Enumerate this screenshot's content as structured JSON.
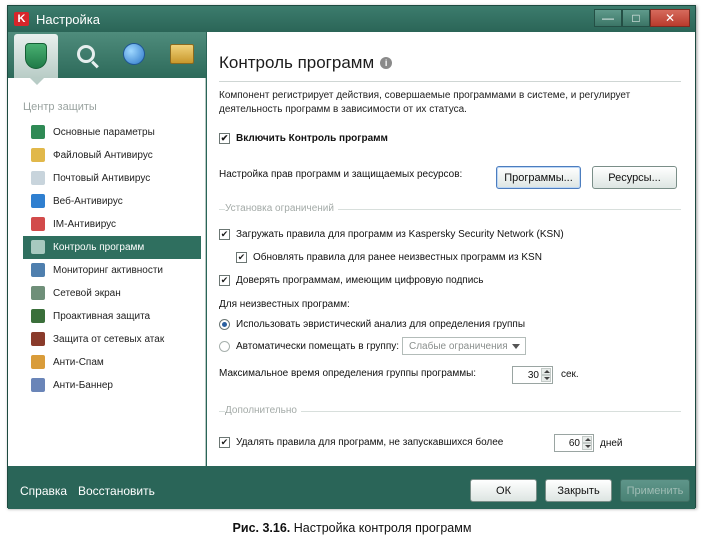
{
  "window": {
    "title": "Настройка",
    "app_icon_letter": "K",
    "controls": [
      "—",
      "□",
      "✕"
    ]
  },
  "sidebar": {
    "tabs": [
      "shield-icon",
      "search-icon",
      "globe-icon",
      "briefcase-icon"
    ],
    "section_title": "Центр защиты",
    "items": [
      {
        "label": "Основные параметры",
        "icon": "shield-icon",
        "color": "#2f8a55"
      },
      {
        "label": "Файловый Антивирус",
        "icon": "folder-icon",
        "color": "#e1b84a"
      },
      {
        "label": "Почтовый Антивирус",
        "icon": "envelope-icon",
        "color": "#c8d4dc"
      },
      {
        "label": "Веб-Антивирус",
        "icon": "globe-icon",
        "color": "#2f7fd0"
      },
      {
        "label": "IM-Антивирус",
        "icon": "chat-icon",
        "color": "#d24b4b"
      },
      {
        "label": "Контроль программ",
        "icon": "filter-icon",
        "color": "#a7c9bf",
        "active": true
      },
      {
        "label": "Мониторинг активности",
        "icon": "monitor-icon",
        "color": "#4f7fae"
      },
      {
        "label": "Сетевой экран",
        "icon": "hourglass-icon",
        "color": "#6f8f79"
      },
      {
        "label": "Проактивная защита",
        "icon": "shield-check-icon",
        "color": "#3a6f3a"
      },
      {
        "label": "Защита от сетевых атак",
        "icon": "computer-icon",
        "color": "#8a3b2b"
      },
      {
        "label": "Анти-Спам",
        "icon": "envelope-warning-icon",
        "color": "#d99c3a"
      },
      {
        "label": "Анти-Баннер",
        "icon": "banner-icon",
        "color": "#6a85b8"
      }
    ]
  },
  "main": {
    "heading": "Контроль программ",
    "help_glyph": "i",
    "description": "Компонент регистрирует действия, совершаемые программами в системе, и регулирует деятельность программ в зависимости от их статуса.",
    "enable_label": "Включить Контроль программ",
    "rights_label": "Настройка прав программ и защищаемых ресурсов:",
    "programs_button": "Программы...",
    "resources_button": "Ресурсы...",
    "group_restrictions": "Установка ограничений",
    "load_ksn": "Загружать правила для программ из Kaspersky Security Network (KSN)",
    "update_rules": "Обновлять правила для ранее неизвестных программ из KSN",
    "trust_signed": "Доверять программам, имеющим цифровую подпись",
    "unknown_label": "Для неизвестных программ:",
    "radio_heuristic": "Использовать эвристический анализ для определения группы",
    "radio_auto": "Автоматически помещать в группу:",
    "group_select": "Слабые ограничения",
    "max_time_label": "Максимальное время определения группы программы:",
    "max_time_value": "30",
    "max_time_unit": "сек.",
    "group_additional": "Дополнительно",
    "delete_rules": "Удалять правила для программ, не запускавшихся более",
    "days_value": "60",
    "days_unit": "дней"
  },
  "footer": {
    "help_link": "Справка",
    "restore_link": "Восстановить",
    "ok": "ОК",
    "close": "Закрыть",
    "apply": "Применить"
  },
  "caption": {
    "prefix": "Рис. 3.16.",
    "text": " Настройка контроля программ"
  }
}
